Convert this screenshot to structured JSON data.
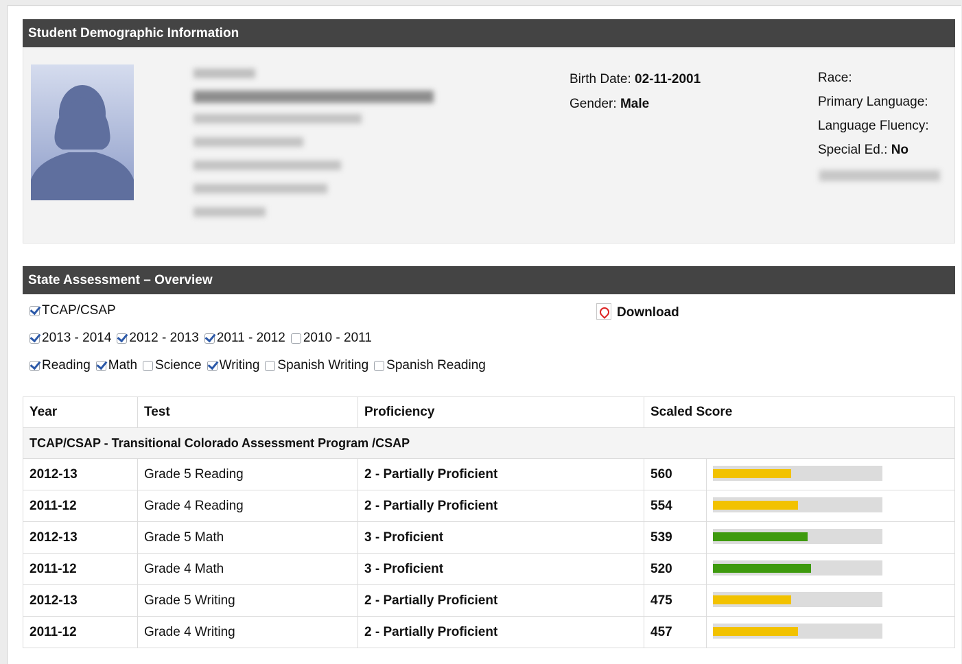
{
  "demographics": {
    "header": "Student Demographic Information",
    "birth_date_label": "Birth Date:",
    "birth_date": "02-11-2001",
    "gender_label": "Gender:",
    "gender": "Male",
    "race_label": "Race:",
    "primary_language_label": "Primary Language:",
    "language_fluency_label": "Language Fluency:",
    "special_ed_label": "Special Ed.:",
    "special_ed": "No"
  },
  "assessment": {
    "header": "State Assessment – Overview",
    "download_label": "Download",
    "test_filters": [
      {
        "label": "TCAP/CSAP",
        "checked": true
      }
    ],
    "year_filters": [
      {
        "label": "2013 - 2014",
        "checked": true
      },
      {
        "label": "2012 - 2013",
        "checked": true
      },
      {
        "label": "2011 - 2012",
        "checked": true
      },
      {
        "label": "2010 - 2011",
        "checked": false
      }
    ],
    "subject_filters": [
      {
        "label": "Reading",
        "checked": true
      },
      {
        "label": "Math",
        "checked": true
      },
      {
        "label": "Science",
        "checked": false
      },
      {
        "label": "Writing",
        "checked": true
      },
      {
        "label": "Spanish Writing",
        "checked": false
      },
      {
        "label": "Spanish Reading",
        "checked": false
      }
    ],
    "columns": [
      "Year",
      "Test",
      "Proficiency",
      "Scaled Score"
    ],
    "group_label": "TCAP/CSAP - Transitional Colorado Assessment Program /CSAP",
    "rows": [
      {
        "year": "2012-13",
        "test": "Grade 5 Reading",
        "proficiency": "2 - Partially Proficient",
        "score": "560",
        "bar_fraction": 0.46,
        "bar_color": "#f2c200"
      },
      {
        "year": "2011-12",
        "test": "Grade 4 Reading",
        "proficiency": "2 - Partially Proficient",
        "score": "554",
        "bar_fraction": 0.5,
        "bar_color": "#f2c200"
      },
      {
        "year": "2012-13",
        "test": "Grade 5 Math",
        "proficiency": "3 - Proficient",
        "score": "539",
        "bar_fraction": 0.56,
        "bar_color": "#3e9a0e"
      },
      {
        "year": "2011-12",
        "test": "Grade 4 Math",
        "proficiency": "3 - Proficient",
        "score": "520",
        "bar_fraction": 0.58,
        "bar_color": "#3e9a0e"
      },
      {
        "year": "2012-13",
        "test": "Grade 5 Writing",
        "proficiency": "2 - Partially Proficient",
        "score": "475",
        "bar_fraction": 0.46,
        "bar_color": "#f2c200"
      },
      {
        "year": "2011-12",
        "test": "Grade 4 Writing",
        "proficiency": "2 - Partially Proficient",
        "score": "457",
        "bar_fraction": 0.5,
        "bar_color": "#f2c200"
      }
    ]
  }
}
